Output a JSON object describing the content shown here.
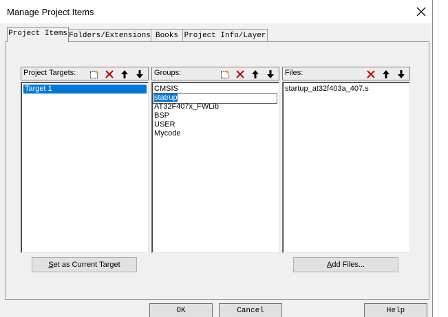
{
  "window": {
    "title": "Manage Project Items",
    "close_glyph": "✕"
  },
  "tabs": [
    {
      "label": "Project Items",
      "active": true
    },
    {
      "label": "Folders/Extensions",
      "active": false
    },
    {
      "label": "Books",
      "active": false
    },
    {
      "label": "Project Info/Layer",
      "active": false
    }
  ],
  "targets_pane": {
    "label": "Project Targets:",
    "toolbar": [
      "new-icon",
      "delete-icon",
      "move-up-icon",
      "move-down-icon"
    ],
    "items": [
      {
        "text": "Target 1",
        "selected": true
      }
    ],
    "button_label": "Set as Current Target",
    "button_accel": "S",
    "button_rest": "et as Current Target"
  },
  "groups_pane": {
    "label": "Groups:",
    "toolbar": [
      "new-icon",
      "delete-icon",
      "move-up-icon",
      "move-down-icon"
    ],
    "items": [
      {
        "text": "CMSIS"
      },
      {
        "text": "statrup",
        "editing": true
      },
      {
        "text": "AT32F407x_FWLib"
      },
      {
        "text": "BSP"
      },
      {
        "text": "USER"
      },
      {
        "text": "Mycode"
      }
    ]
  },
  "files_pane": {
    "label": "Files:",
    "toolbar": [
      "delete-icon",
      "move-up-icon",
      "move-down-icon"
    ],
    "items": [
      {
        "text": "startup_at32f403a_407.s"
      }
    ],
    "button_label": "Add Files...",
    "button_accel": "A",
    "button_rest": "dd Files..."
  },
  "dialog_buttons": {
    "ok": "OK",
    "cancel": "Cancel",
    "help": "Help"
  },
  "colors": {
    "selection": "#0078d7",
    "delete_icon": "#c00000",
    "face": "#f0f0f0"
  }
}
